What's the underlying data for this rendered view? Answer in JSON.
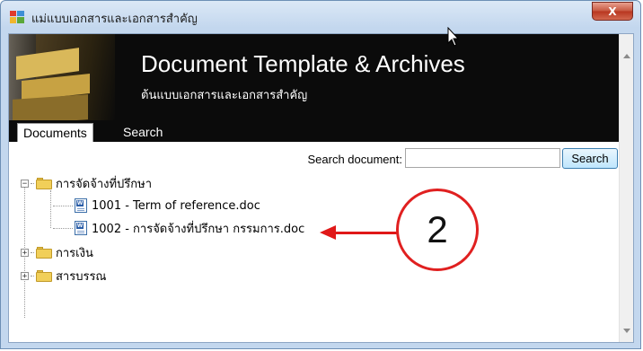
{
  "window": {
    "title": "แม่แบบเอกสารและเอกสารสำคัญ",
    "close_label": "X"
  },
  "banner": {
    "title": "Document Template & Archives",
    "subtitle": "ต้นแบบเอกสารและเอกสารสำคัญ"
  },
  "tabs": [
    {
      "label": "Documents",
      "active": true
    },
    {
      "label": "Search",
      "active": false
    }
  ],
  "search": {
    "label": "Search document:",
    "value": "",
    "button_label": "Search"
  },
  "tree": {
    "folders": [
      {
        "label": "การจัดจ้างที่ปรึกษา",
        "expanded": true,
        "expander": "−",
        "files": [
          {
            "label": "1001 - Term of reference.doc"
          },
          {
            "label": "1002 - การจัดจ้างที่ปรึกษา กรรมการ.doc"
          }
        ]
      },
      {
        "label": "การเงิน",
        "expanded": false,
        "expander": "+"
      },
      {
        "label": "สารบรรณ",
        "expanded": false,
        "expander": "+"
      }
    ]
  },
  "callout": {
    "number": "2",
    "color": "#e02020"
  },
  "icons": {
    "app": "app-window-icon",
    "folder": "folder-icon",
    "word_doc": "word-document-icon"
  }
}
